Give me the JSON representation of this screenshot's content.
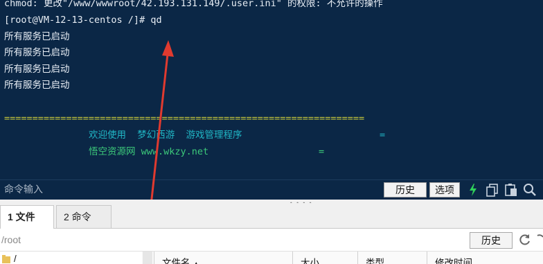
{
  "terminal": {
    "lines": [
      "chmod: 更改\"/www/wwwroot/42.193.131.149/.user.ini\" 的权限: 不允许的操作",
      "[root@VM-12-13-centos /]# qd",
      "所有服务已启动",
      "所有服务已启动",
      "所有服务已启动",
      "所有服务已启动",
      "",
      "================================================================"
    ],
    "banner": {
      "row1": "欢迎使用  梦幻西游  游戏管理程序",
      "row1_end": "=",
      "row2": "悟空资源网 www.wkzy.net",
      "row2_end": "="
    }
  },
  "command_bar": {
    "placeholder": "命令输入",
    "history_label": "历史",
    "options_label": "选项",
    "icons": [
      "lightning-icon",
      "copy-icon",
      "paste-icon",
      "search-icon"
    ]
  },
  "tabs": [
    {
      "label": "1 文件",
      "active": true
    },
    {
      "label": "2 命令",
      "active": false
    }
  ],
  "path_bar": {
    "value": "/root",
    "history_label": "历史"
  },
  "file_table": {
    "tree_root": "/",
    "columns": [
      "文件名",
      "大小",
      "类型",
      "修改时间"
    ]
  },
  "colors": {
    "terminal_bg": "#0b2746",
    "terminal_text": "#e8eef5",
    "separator": "#c9c93a",
    "banner_cyan": "#20b5c4",
    "arrow": "#e03a2f",
    "lightning": "#2fd15a"
  }
}
